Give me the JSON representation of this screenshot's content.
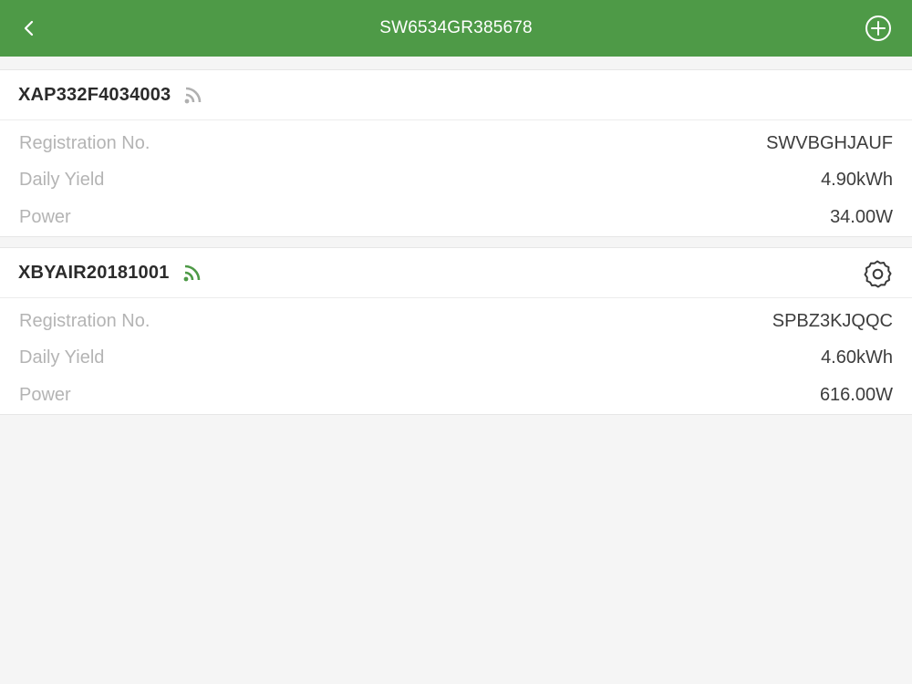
{
  "header": {
    "title": "SW6534GR385678",
    "back_icon": "chevron-left-icon",
    "add_icon": "plus-circle-icon"
  },
  "devices": [
    {
      "name": "XAP332F4034003",
      "signal_icon": "wifi-signal-icon",
      "signal_color": "#b0b0b0",
      "rows": [
        {
          "label": "Registration No.",
          "value": "SWVBGHJAUF"
        },
        {
          "label": "Daily Yield",
          "value": "4.90kWh"
        },
        {
          "label": "Power",
          "value": "34.00W"
        }
      ]
    },
    {
      "name": "XBYAIR20181001",
      "signal_icon": "wifi-signal-icon",
      "signal_color": "#4e9a47",
      "settings_icon": "gear-icon",
      "rows": [
        {
          "label": "Registration No.",
          "value": "SPBZ3KJQQC"
        },
        {
          "label": "Daily Yield",
          "value": "4.60kWh"
        },
        {
          "label": "Power",
          "value": "616.00W"
        }
      ]
    }
  ],
  "colors": {
    "accent": "#4e9a47",
    "background": "#f5f5f5"
  }
}
